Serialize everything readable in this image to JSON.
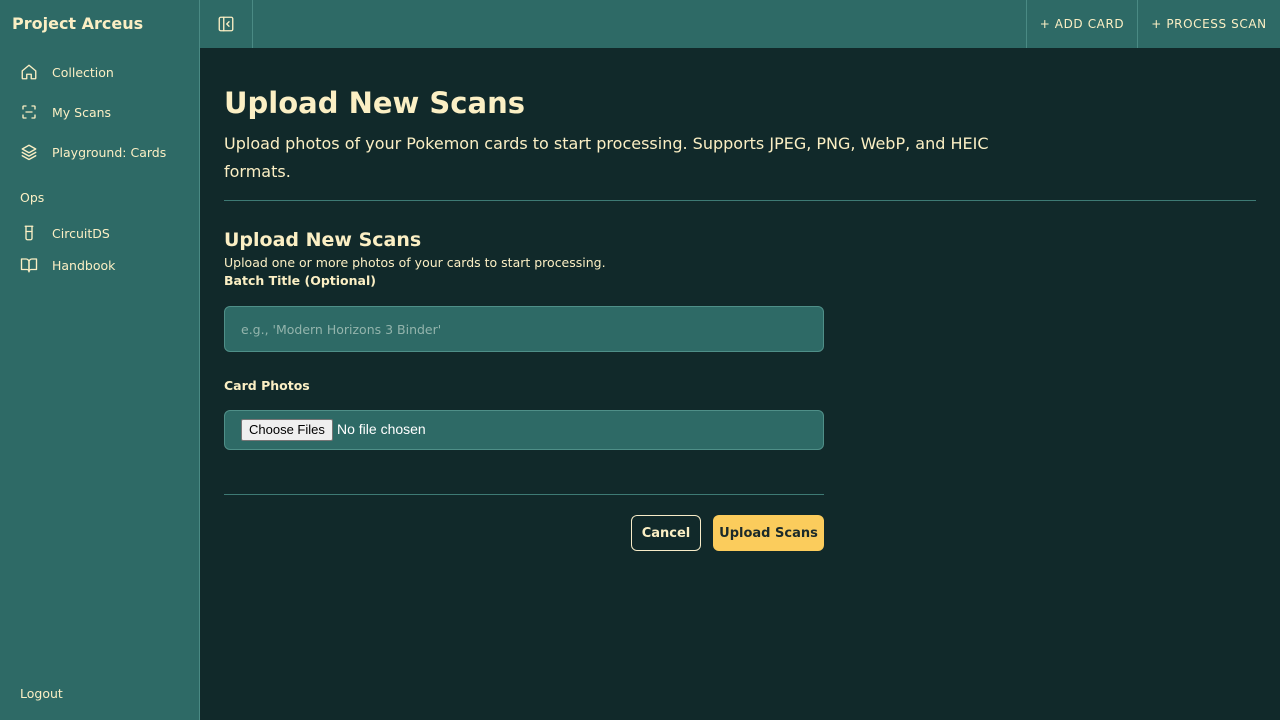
{
  "app": {
    "title": "Project Arceus"
  },
  "sidebar": {
    "items": [
      {
        "label": "Collection",
        "icon": "home-icon"
      },
      {
        "label": "My Scans",
        "icon": "scan-icon"
      },
      {
        "label": "Playground: Cards",
        "icon": "layers-icon"
      }
    ],
    "section_label": "Ops",
    "ops_items": [
      {
        "label": "CircuitDS",
        "icon": "beaker-icon"
      },
      {
        "label": "Handbook",
        "icon": "book-icon"
      }
    ],
    "logout_label": "Logout"
  },
  "topbar": {
    "add_card_label": "+ ADD CARD",
    "process_scan_label": "+ PROCESS SCAN"
  },
  "page": {
    "title": "Upload New Scans",
    "description": "Upload photos of your Pokemon cards to start processing. Supports JPEG, PNG, WebP, and HEIC formats."
  },
  "form": {
    "title": "Upload New Scans",
    "description": "Upload one or more photos of your cards to start processing.",
    "batch_title_label": "Batch Title (Optional)",
    "batch_title_placeholder": "e.g., 'Modern Horizons 3 Binder'",
    "batch_title_value": "",
    "card_photos_label": "Card Photos",
    "choose_files_label": "Choose Files",
    "file_status": "No file chosen",
    "cancel_label": "Cancel",
    "upload_label": "Upload Scans"
  },
  "colors": {
    "background": "#11292a",
    "sidebar": "#2e6a66",
    "text": "#fbefc4",
    "accent": "#fbcc5c"
  }
}
